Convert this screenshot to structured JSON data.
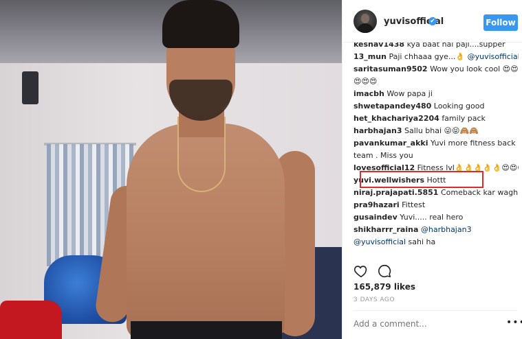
{
  "header": {
    "username": "yuvisofficial",
    "follow_label": "Follow",
    "verified_icon": "verified-badge-icon"
  },
  "comments": [
    {
      "user": "keshav1438",
      "text": "kya baat hai paji....supper"
    },
    {
      "user": "13_mun",
      "text": "Paji chhaaa gye...👌 ",
      "mention": "@yuvisofficial"
    },
    {
      "user": "saritasuman9502",
      "text": "Wow you look cool 😍😍😍😍😍"
    },
    {
      "user": "imacbh",
      "text": "Wow papa ji"
    },
    {
      "user": "shwetapandey480",
      "text": "Looking good"
    },
    {
      "user": "het_khachariya2204",
      "text": "family pack"
    },
    {
      "user": "harbhajan3",
      "text": "Sallu bhai 😜😝🙈🙈"
    },
    {
      "user": "pavankumar_akki",
      "text": "Yuvi more fitness back team . Miss you"
    },
    {
      "user": "lovesofficial12",
      "text": "Fitness lvl👌👌👌👌👌😍😍😍"
    },
    {
      "user": "yuvi.wellwishers",
      "text": "Hottt"
    },
    {
      "user": "niraj.prajapati.5851",
      "text": "Comeback kar waghri"
    },
    {
      "user": "pra9hazari",
      "text": "Fittest"
    },
    {
      "user": "gusaindev",
      "text": "Yuvi..... real hero"
    },
    {
      "user": "shikharrr_raina",
      "mention": "@harbhajan3",
      "mention2": "@yuvisofficial",
      "text": " sahi ha"
    }
  ],
  "actions": {
    "like_icon": "heart-icon",
    "comment_icon": "comment-icon"
  },
  "likes": "165,879 likes",
  "timestamp": "3 DAYS AGO",
  "add_comment_placeholder": "Add a comment...",
  "more_label": "•••",
  "colors": {
    "follow_button": "#3897f0",
    "highlight_box": "#e02a2a",
    "mention": "#003569"
  }
}
